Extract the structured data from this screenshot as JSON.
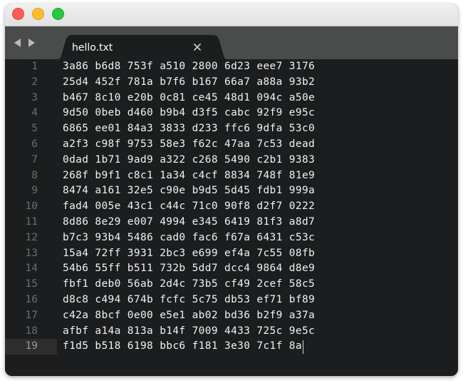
{
  "window": {
    "traffic_lights": {
      "close_color": "#fe5f57",
      "minimize_color": "#febc2e",
      "maximize_color": "#28c840"
    }
  },
  "tabbar": {
    "back_icon": "chevron-left-icon",
    "forward_icon": "chevron-right-icon",
    "tab": {
      "label": "hello.txt",
      "close_icon": "close-icon"
    }
  },
  "editor": {
    "current_line": 19,
    "lines": [
      {
        "num": "1",
        "text": "3a86 b6d8 753f a510 2800 6d23 eee7 3176"
      },
      {
        "num": "2",
        "text": "25d4 452f 781a b7f6 b167 66a7 a88a 93b2"
      },
      {
        "num": "3",
        "text": "b467 8c10 e20b 0c81 ce45 48d1 094c a50e"
      },
      {
        "num": "4",
        "text": "9d50 0beb d460 b9b4 d3f5 cabc 92f9 e95c"
      },
      {
        "num": "5",
        "text": "6865 ee01 84a3 3833 d233 ffc6 9dfa 53c0"
      },
      {
        "num": "6",
        "text": "a2f3 c98f 9753 58e3 f62c 47aa 7c53 dead"
      },
      {
        "num": "7",
        "text": "0dad 1b71 9ad9 a322 c268 5490 c2b1 9383"
      },
      {
        "num": "8",
        "text": "268f b9f1 c8c1 1a34 c4cf 8834 748f 81e9"
      },
      {
        "num": "9",
        "text": "8474 a161 32e5 c90e b9d5 5d45 fdb1 999a"
      },
      {
        "num": "10",
        "text": "fad4 005e 43c1 c44c 71c0 90f8 d2f7 0222"
      },
      {
        "num": "11",
        "text": "8d86 8e29 e007 4994 e345 6419 81f3 a8d7"
      },
      {
        "num": "12",
        "text": "b7c3 93b4 5486 cad0 fac6 f67a 6431 c53c"
      },
      {
        "num": "13",
        "text": "15a4 72ff 3931 2bc3 e699 ef4a 7c55 08fb"
      },
      {
        "num": "14",
        "text": "54b6 55ff b511 732b 5dd7 dcc4 9864 d8e9"
      },
      {
        "num": "15",
        "text": "fbf1 deb0 56ab 2d4c 73b5 cf49 2cef 58c5"
      },
      {
        "num": "16",
        "text": "d8c8 c494 674b fcfc 5c75 db53 ef71 bf89"
      },
      {
        "num": "17",
        "text": "c42a 8bcf 0e00 e5e1 ab02 bd36 b2f9 a37a"
      },
      {
        "num": "18",
        "text": "afbf a14a 813a b14f 7009 4433 725c 9e5c"
      },
      {
        "num": "19",
        "text": "f1d5 b518 6198 bbc6 f181 3e30 7c1f 8a"
      }
    ]
  }
}
